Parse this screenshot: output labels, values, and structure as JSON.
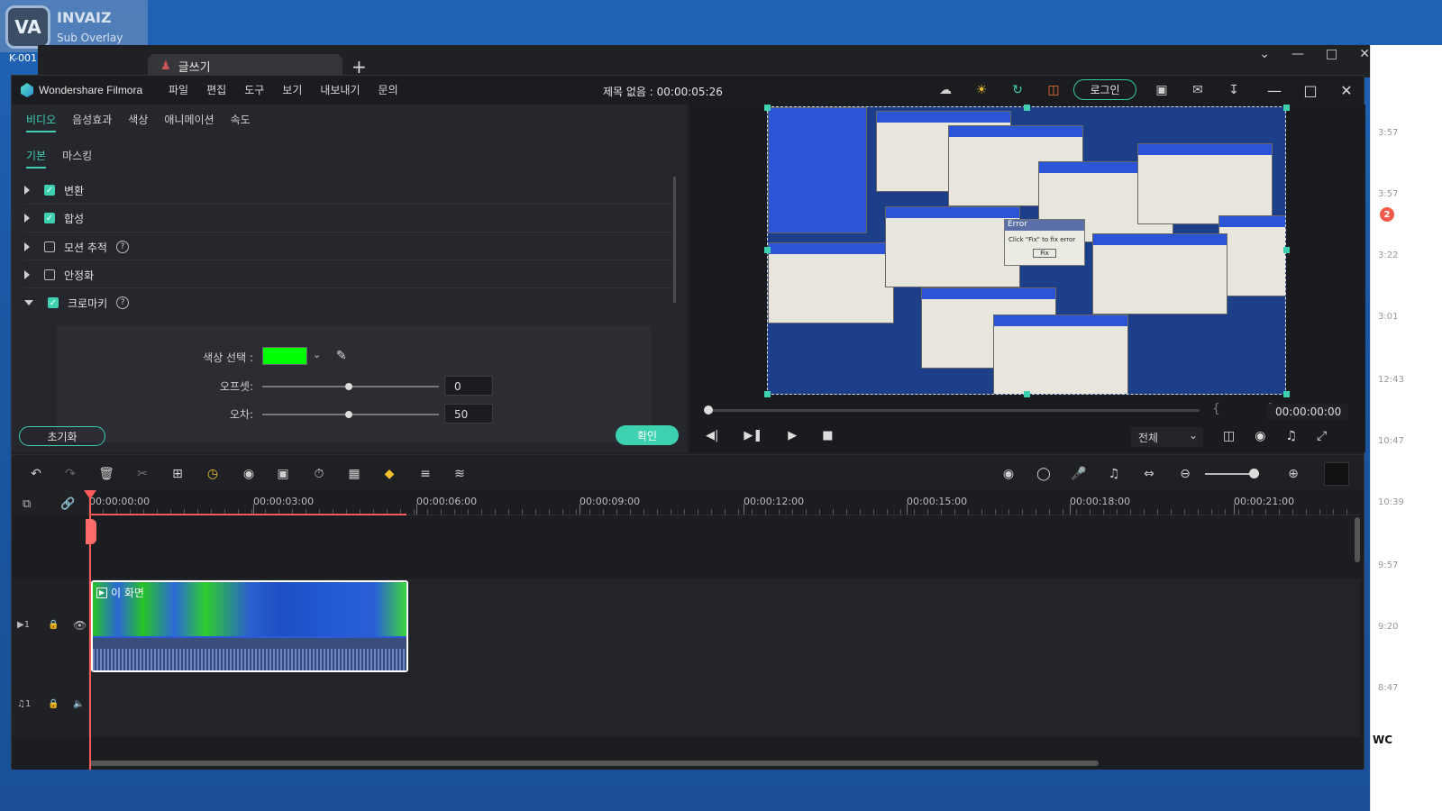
{
  "overlay": {
    "title": "INVAIZ",
    "subtitle": "Sub Overlay",
    "logo_text": "VA",
    "k_label": "K-001"
  },
  "browser": {
    "tab_label": "글쓰기",
    "plus": "+"
  },
  "right_panel": {
    "times": [
      "3:57",
      "3:57",
      "3:22",
      "3:01",
      "12:43",
      "10:47",
      "10:39",
      "9:57",
      "9:20",
      "8:47"
    ],
    "badge": "2",
    "bottom_text": "WC"
  },
  "app": {
    "brand": "Wondershare Filmora",
    "menu": [
      "파일",
      "편집",
      "도구",
      "보기",
      "내보내기",
      "문의"
    ],
    "doc_title": "제목 없음 : 00:00:05:26",
    "login": "로그인"
  },
  "left_panel": {
    "tabs": [
      "비디오",
      "음성효과",
      "색상",
      "애니메이션",
      "속도"
    ],
    "subtabs": [
      "기본",
      "마스킹"
    ],
    "props": [
      {
        "label": "변환",
        "checked": true
      },
      {
        "label": "합성",
        "checked": true
      },
      {
        "label": "모션 추적",
        "checked": false
      },
      {
        "label": "안정화",
        "checked": false
      },
      {
        "label": "크로마키",
        "checked": true
      }
    ],
    "chroma": {
      "color_label": "색상 선택 :",
      "color": "#00ff00",
      "offset_label": "오프셋:",
      "offset_value": "0",
      "tolerance_label": "오차:",
      "tolerance_value": "50"
    },
    "reset": "초기화",
    "ok": "확인"
  },
  "preview": {
    "time": "00:00:00:00",
    "braces": "{ }",
    "quality": "전체",
    "error_title": "Error",
    "error_msg": "Click \"Fix\" to fix error",
    "error_btn": "Fix"
  },
  "timeline": {
    "ruler": [
      "00:00:00:00",
      "00:00:03:00",
      "00:00:06:00",
      "00:00:09:00",
      "00:00:12:00",
      "00:00:15:00",
      "00:00:18:00",
      "00:00:21:00"
    ],
    "clip_title": "이 화면",
    "video_track": "1",
    "audio_track": "1"
  }
}
